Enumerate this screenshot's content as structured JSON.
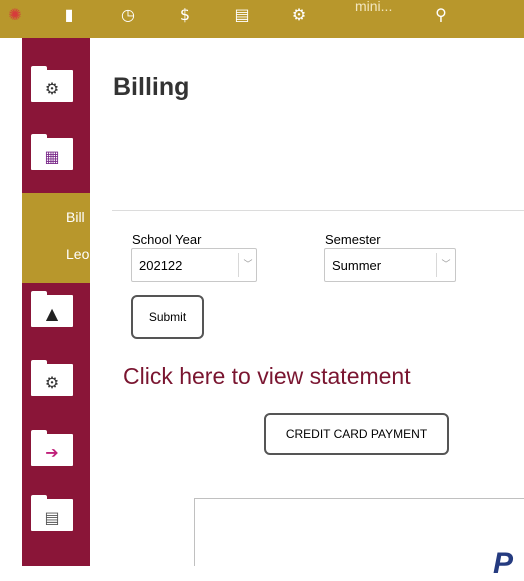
{
  "topbar": {
    "icons": [
      "emblem-icon",
      "home-icon",
      "clock-icon",
      "dollar-icon",
      "document-icon",
      "gear-icon",
      "search-icon"
    ],
    "cut_text": "mini..."
  },
  "sidebar": {
    "items": [
      {
        "name": "settings-folder",
        "icon": "gear-icon"
      },
      {
        "name": "billing-folder",
        "icon": "calculator-card-icon"
      },
      {
        "name": "academics-folder",
        "icon": "graduation-cap-icon"
      },
      {
        "name": "settings-alt-folder",
        "icon": "gear-pencil-icon"
      },
      {
        "name": "exit-folder",
        "icon": "exit-arrow-icon"
      },
      {
        "name": "notes-folder",
        "icon": "notepad-icon"
      }
    ],
    "submenu": [
      "Bill",
      "Leo"
    ]
  },
  "page": {
    "title": "Billing"
  },
  "form": {
    "school_year_label": "School Year",
    "school_year_value": "202122",
    "semester_label": "Semester",
    "semester_value": "Summer",
    "submit_label": "Submit"
  },
  "statement_link": "Click here to view statement",
  "credit_card_button": "CREDIT CARD PAYMENT",
  "paypal_partial": "P",
  "colors": {
    "maroon": "#8a1538",
    "gold": "#b8972c",
    "link": "#7a1530"
  }
}
